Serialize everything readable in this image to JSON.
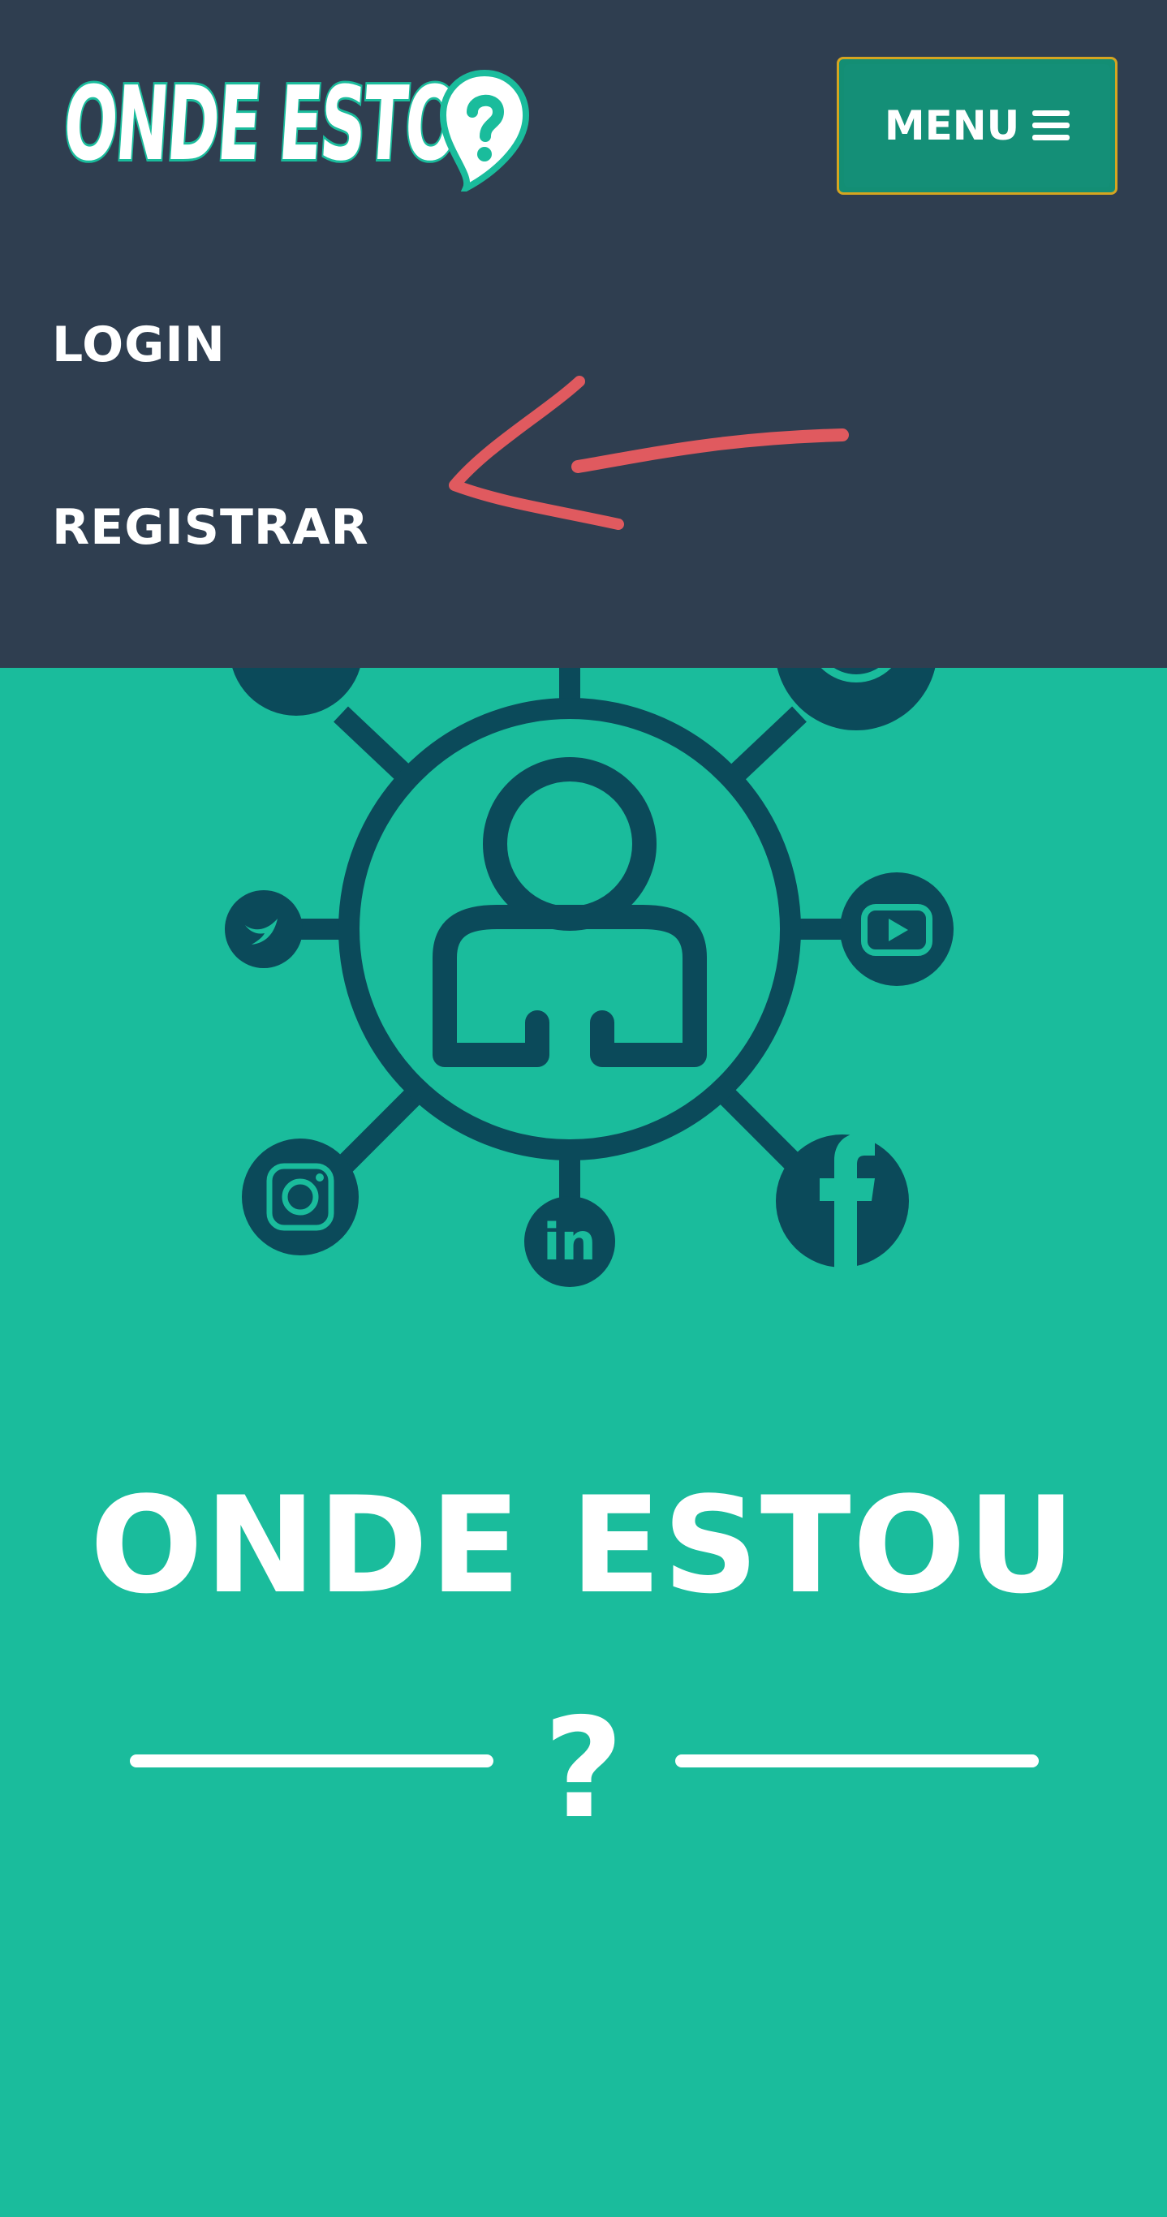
{
  "header": {
    "brand_text": "ONDE ESTOU",
    "brand_icon": "location-pin-question-icon",
    "menu_button_label": "MENU",
    "menu_icon": "hamburger-icon"
  },
  "nav": {
    "items": [
      {
        "label": "LOGIN"
      },
      {
        "label": "REGISTRAR"
      }
    ]
  },
  "annotation": {
    "icon": "red-arrow-annotation-icon",
    "color": "#e05a5f"
  },
  "hero": {
    "graphic_icon": "social-network-hub-icon",
    "social_icons": [
      "messenger-icon",
      "whatsapp-icon",
      "twitter-icon",
      "youtube-icon",
      "instagram-icon",
      "linkedin-icon",
      "facebook-icon",
      "user-icon"
    ],
    "title": "ONDE ESTOU",
    "divider_mark": "?"
  },
  "colors": {
    "navbar_bg": "#2f3e50",
    "page_bg": "#1abc9c",
    "menu_button_bg": "#148f77",
    "menu_button_border": "#d5a520",
    "graphic_color": "#0b4a5a",
    "text": "#ffffff"
  }
}
